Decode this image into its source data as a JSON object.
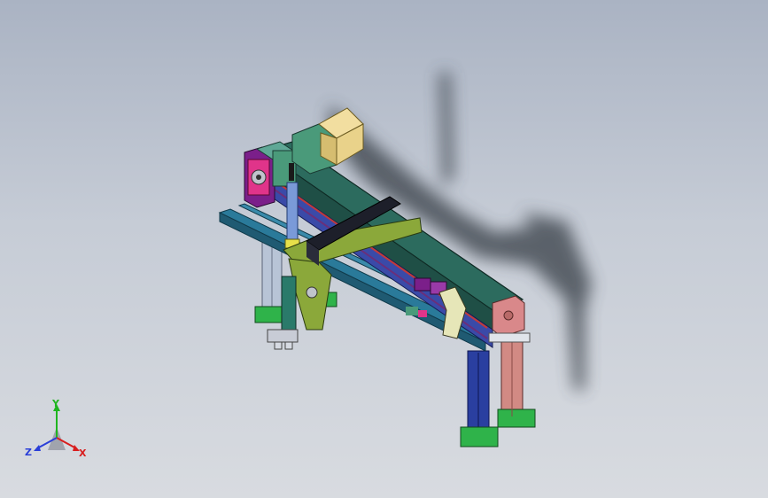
{
  "viewport": {
    "background_top": "#aab3c3",
    "background_bottom": "#d8dbe0"
  },
  "model": {
    "colors": {
      "motor": "#e9d28a",
      "motor_flange": "#4a9a7a",
      "end_plate_left": "#7b1f8a",
      "end_plate_right": "#d9888a",
      "beam_top": "#2c6b5e",
      "beam_side": "#1f4f46",
      "base_rail": "#2a7a9a",
      "carriage_plate": "#8ba83a",
      "black_bracket": "#1d1f2a",
      "leg_blue": "#2a3fa0",
      "leg_pink": "#d28a84",
      "foot_green": "#2fb34a",
      "shadow": "#3f4650"
    }
  },
  "triad": {
    "y_label": "Y",
    "z_label": "Z",
    "x_label": "X",
    "y_color": "#1fb51f",
    "z_color": "#2a3fd8",
    "x_color": "#d81e1e"
  }
}
